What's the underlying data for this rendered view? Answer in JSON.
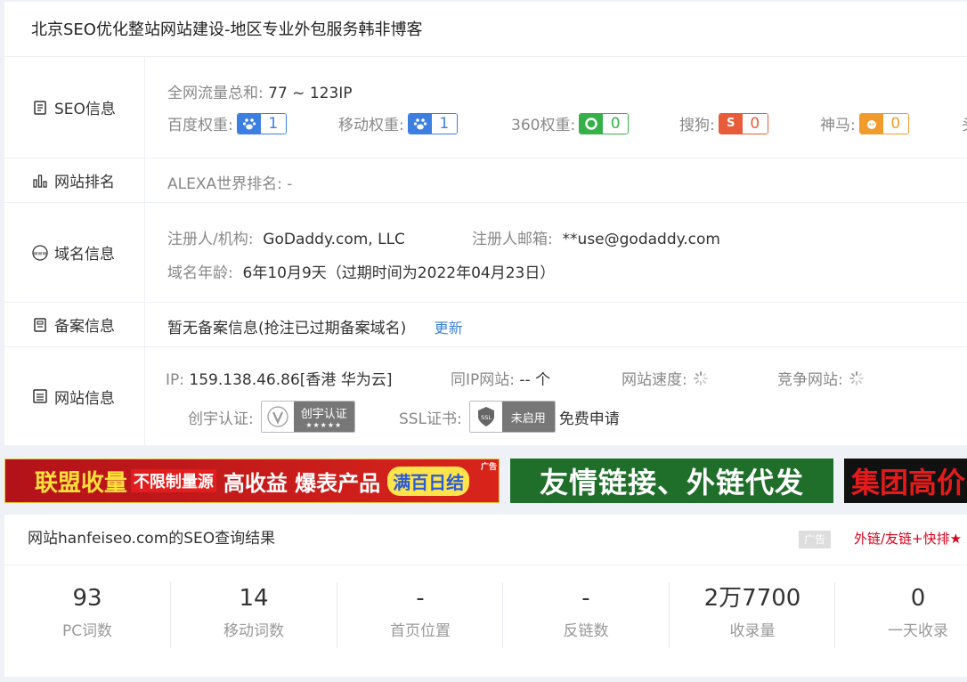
{
  "title": "北京SEO优化整站网站建设-地区专业外包服务韩非博客",
  "rows": {
    "seo": {
      "label": "SEO信息",
      "traffic_label": "全网流量总和:",
      "traffic_value": "77 ~ 123IP",
      "weights": [
        {
          "label": "百度权重:",
          "value": "1",
          "icon": "baidu-paw-icon",
          "color": "#3d7fe0"
        },
        {
          "label": "移动权重:",
          "value": "1",
          "icon": "baidu-paw-icon",
          "color": "#3d7fe0"
        },
        {
          "label": "360权重:",
          "value": "0",
          "icon": "360-icon",
          "color": "#36b14a"
        },
        {
          "label": "搜狗:",
          "value": "0",
          "icon": "sogou-icon",
          "color": "#e85c3a"
        },
        {
          "label": "神马:",
          "value": "0",
          "icon": "shenma-icon",
          "color": "#f19b2c"
        }
      ],
      "overflow_char": "头"
    },
    "rank": {
      "label": "网站排名",
      "alexa_label": "ALEXA世界排名:",
      "alexa_value": "-"
    },
    "domain": {
      "label": "域名信息",
      "registrant_label": "注册人/机构:",
      "registrant_value": "GoDaddy.com, LLC",
      "email_label": "注册人邮箱:",
      "email_value": "**use@godaddy.com",
      "age_label": "域名年龄:",
      "age_value": "6年10月9天（过期时间为2022年04月23日）"
    },
    "icp": {
      "label": "备案信息",
      "value": "暂无备案信息(抢注已过期备案域名)",
      "update": "更新"
    },
    "site": {
      "label": "网站信息",
      "ip_label": "IP:",
      "ip_value": "159.138.46.86[香港 华为云]",
      "sameip_label": "同IP网站:",
      "sameip_value": "-- 个",
      "speed_label": "网站速度:",
      "compete_label": "竞争网站:",
      "chuangyu_label": "创宇认证:",
      "chuangyu_badge": "创宇认证",
      "chuangyu_stars": "★★★★★",
      "ssl_label": "SSL证书:",
      "ssl_badge": "未启用",
      "ssl_icon_text": "SSL",
      "ssl_apply": "免费申请"
    }
  },
  "ads": [
    {
      "text": "联盟收量",
      "text2": "不限制量源",
      "text3": "高收益 爆表产品",
      "text4": "满百日结",
      "tag": "广告"
    },
    {
      "text": "友情链接、外链代发"
    },
    {
      "text": "集团高价"
    }
  ],
  "result": {
    "title": "网站hanfeiseo.com的SEO查询结果",
    "ad_tag": "广告",
    "ext_link": "外链/友链+快排★",
    "stats": [
      {
        "num": "93",
        "label": "PC词数"
      },
      {
        "num": "14",
        "label": "移动词数"
      },
      {
        "num": "-",
        "label": "首页位置"
      },
      {
        "num": "-",
        "label": "反链数"
      },
      {
        "num": "2万7700",
        "label": "收录量"
      },
      {
        "num": "0",
        "label": "一天收录"
      }
    ]
  },
  "colors": {
    "accent_blue": "#3b82d6",
    "ad_red": "#d9001b"
  }
}
